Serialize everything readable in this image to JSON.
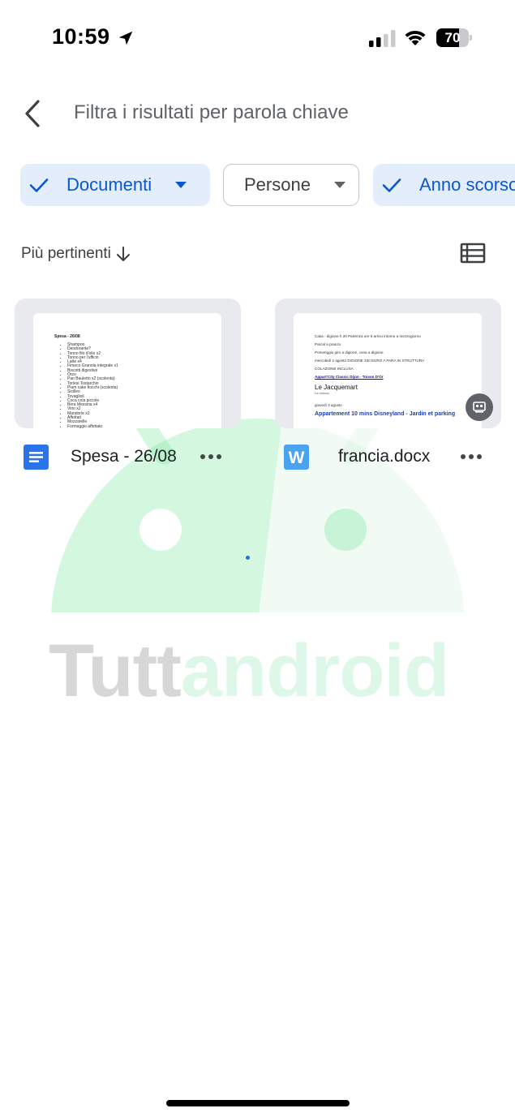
{
  "status_bar": {
    "time": "10:59",
    "battery_level": "70",
    "battery_fraction": 0.7
  },
  "search": {
    "text": "Filtra i risultati per parola chiave"
  },
  "chips": {
    "documents": {
      "label": "Documenti",
      "selected": true
    },
    "people": {
      "label": "Persone",
      "selected": false
    },
    "last_year": {
      "label": "Anno scorso",
      "selected": true
    }
  },
  "sort": {
    "label": "Più pertinenti"
  },
  "files": [
    {
      "name": "Spesa - 26/08",
      "type": "google-docs",
      "preview": {
        "title": "Spesa - 26/08",
        "items": [
          "Shampoo",
          "Deodorante?",
          "Tonno filo d'olio x2",
          "Tonno per l'ufficio",
          "Latte x4",
          "Fimeco Granola integrale x1",
          "Biscotti digestive",
          "Orzo",
          "Pan Bauletto x2 (scolenta)",
          "Torlesi Tostarchio",
          "Plum cake fiocchi (scolenta)",
          "Sicilleo",
          "Tovaglioli",
          "Coca cola piccole",
          "Birra Messina x4",
          "Vino x2",
          "Mandorle x2",
          "Affettati",
          "Mozzarelle",
          "Formaggio affettato",
          "Formaggio 20 mesi x1"
        ]
      }
    },
    {
      "name": "francia.docx",
      "type": "word",
      "icon_letter": "W",
      "preview": {
        "lines": [
          "Casa - digione h 20 Partenza ore 5 arrivo intorno a mezzogiorno",
          "Parcel a pranzo",
          "Pomeriggio giro a digione, cena a digione",
          "mercoledì 2 agosto DIGIONE 150 EURO A PARA IN STRUTTURA",
          "COLAZIONE INCLUSA"
        ],
        "link": "Appart'City Classic Dijon - Toison D'Or",
        "heading": "Le Jacquemart",
        "subheading": "La ricerca",
        "date_line": "giovedì 3 agosto",
        "blue_heading": "Appartement 10 mins Disneyland - Jardin et parking"
      }
    }
  ],
  "watermark": {
    "text_part1": "Tutt",
    "text_part2": "android"
  },
  "colors": {
    "accent_blue": "#0b57d0",
    "chip_active_bg": "#e3edfb",
    "docs_blue": "#2a73e8",
    "word_blue": "#4aa3f0"
  }
}
